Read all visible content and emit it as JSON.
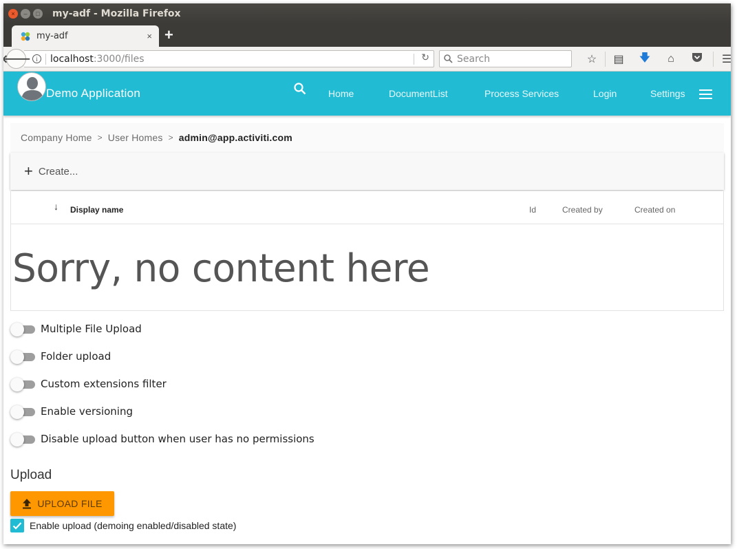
{
  "window": {
    "title": "my-adf - Mozilla Firefox",
    "controls": [
      "close",
      "minimize",
      "maximize"
    ]
  },
  "browser": {
    "tab": {
      "title": "my-adf",
      "close_glyph": "×"
    },
    "new_tab_glyph": "+",
    "url": {
      "host": "localhost",
      "rest": ":3000/files"
    },
    "search_placeholder": "Search",
    "toolbar_icons": [
      "bookmark-star-icon",
      "reading-list-icon",
      "download-icon",
      "home-icon",
      "pocket-icon",
      "menu-icon"
    ]
  },
  "app": {
    "title": "Demo Application",
    "nav": [
      "Home",
      "DocumentList",
      "Process Services",
      "Login",
      "Settings"
    ],
    "colors": {
      "primary": "#21bcd3",
      "accent": "#ff9800"
    }
  },
  "breadcrumb": {
    "items": [
      "Company Home",
      "User Homes"
    ],
    "current": "admin@app.activiti.com",
    "separator": ">"
  },
  "create": {
    "label": "Create..."
  },
  "doclist": {
    "columns": [
      "Display name",
      "Id",
      "Created by",
      "Created on"
    ],
    "sort_indicator": "↓",
    "empty_message": "Sorry, no content here"
  },
  "toggles": [
    {
      "label": "Multiple File Upload",
      "checked": false
    },
    {
      "label": "Folder upload",
      "checked": false
    },
    {
      "label": "Custom extensions filter",
      "checked": false
    },
    {
      "label": "Enable versioning",
      "checked": false
    },
    {
      "label": "Disable upload button when user has no permissions",
      "checked": false
    }
  ],
  "upload": {
    "title": "Upload",
    "button_label": "UPLOAD FILE",
    "enable_label": "Enable upload (demoing enabled/disabled state)",
    "enable_checked": true
  }
}
